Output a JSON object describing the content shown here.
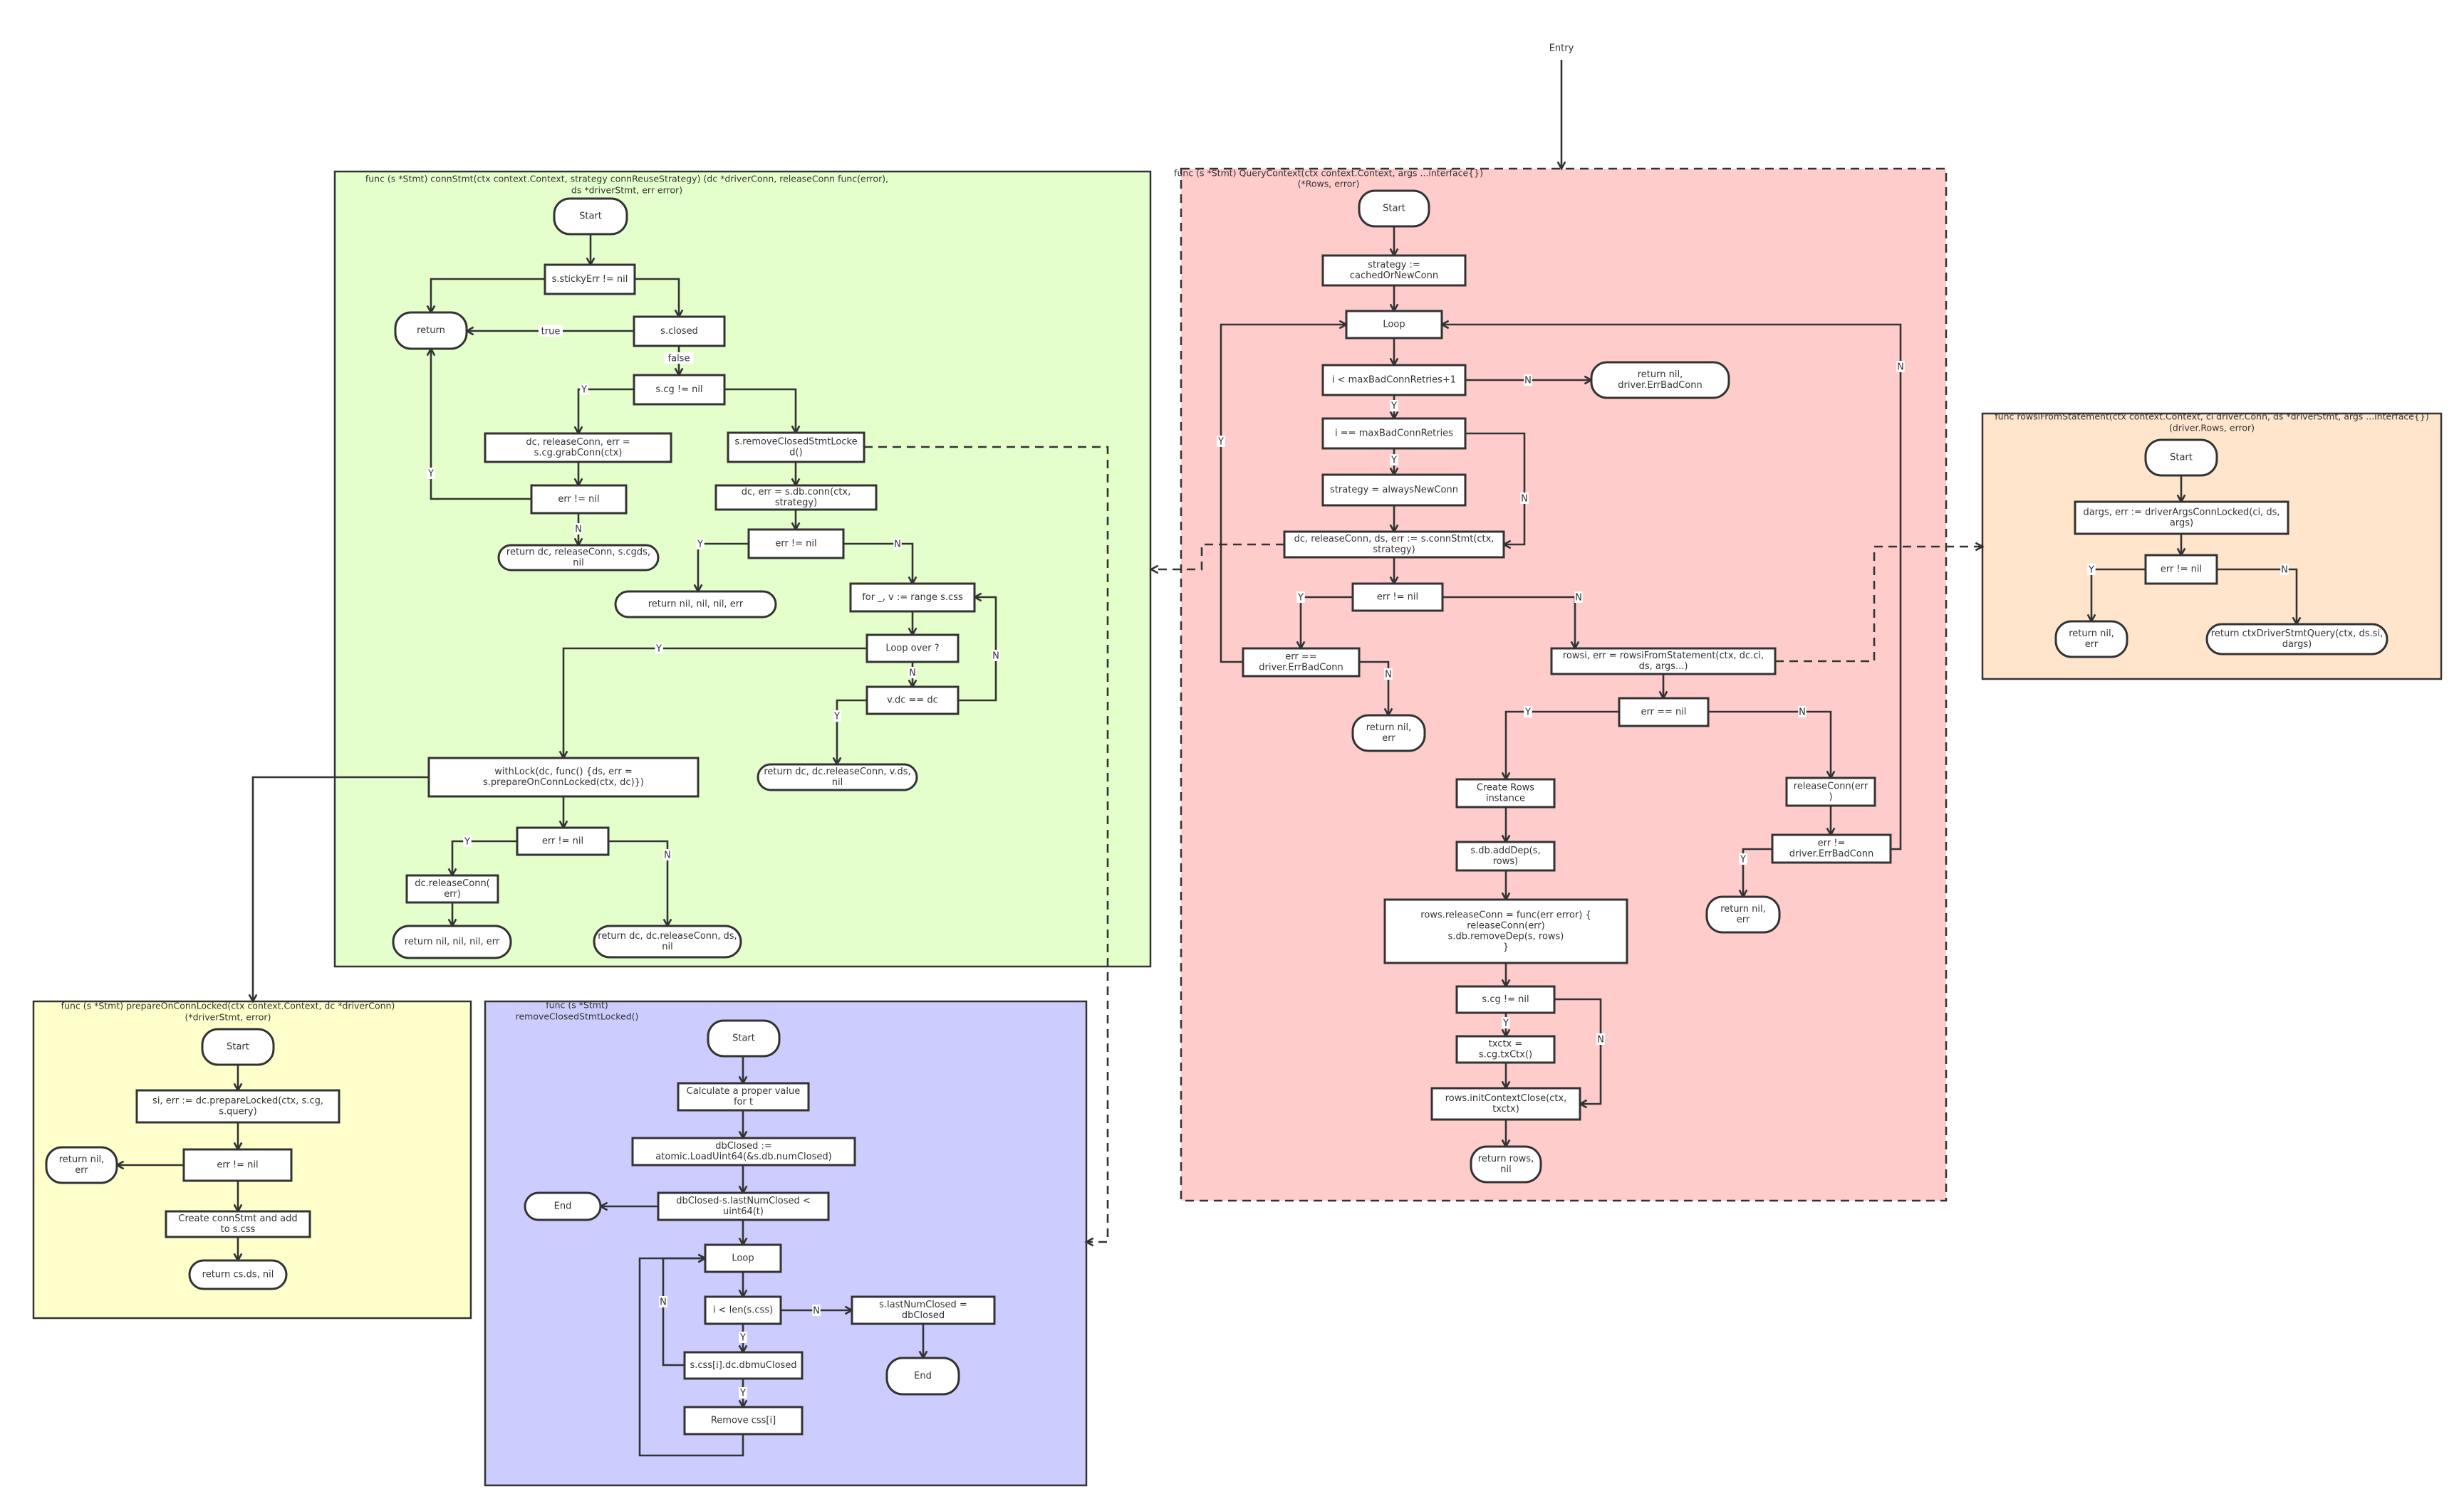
{
  "entry_label": "Entry",
  "colors": {
    "query_context_panel": "#ffcccc",
    "conn_stmt_panel": "#e5ffcc",
    "rowsi_panel": "#ffe5cc",
    "prepare_panel": "#ffffcc",
    "remove_closed_panel": "#ccccff",
    "node_white": "#ffffff",
    "node_conn_stmt": "#e5ffcc",
    "node_rowsi": "#ffe5cc",
    "node_grab_conn": "#ccccff",
    "node_remove_closed": "#ccffff",
    "node_with_lock": "#ffffcc",
    "stroke": "#333333"
  },
  "panels": [
    {
      "id": "query_context",
      "title": [
        "func (s *Stmt) QueryContext(ctx context.Context, args ...interface{})",
        "(*Rows, error)"
      ]
    },
    {
      "id": "conn_stmt",
      "title": [
        "func (s *Stmt) connStmt(ctx context.Context, strategy connReuseStrategy) (dc *driverConn, releaseConn func(error),",
        "ds *driverStmt, err error)"
      ]
    },
    {
      "id": "rowsi",
      "title": [
        "func rowsiFromStatement(ctx context.Context, ci driver.Conn, ds *driverStmt, args ...interface{})",
        "(driver.Rows, error)"
      ]
    },
    {
      "id": "prepare",
      "title": [
        "func (s *Stmt) prepareOnConnLocked(ctx context.Context, dc *driverConn)",
        "(*driverStmt, error)"
      ]
    },
    {
      "id": "remove_closed",
      "title": [
        "func (s *Stmt)",
        "removeClosedStmtLocked()"
      ]
    }
  ],
  "nodes": {
    "qc_start": [
      "Start"
    ],
    "qc_strategy_init": [
      "strategy :=",
      "cachedOrNewConn"
    ],
    "qc_loop": [
      "Loop"
    ],
    "qc_retry_check": [
      "i < maxBadConnRetries+1"
    ],
    "qc_return_bad_conn": [
      "return nil,",
      "driver.ErrBadConn"
    ],
    "qc_last_retry_check": [
      "i == maxBadConnRetries"
    ],
    "qc_strategy_always": [
      "strategy = alwaysNewConn"
    ],
    "qc_conn_stmt_call": [
      "dc, releaseConn, ds, err := s.connStmt(ctx,",
      "strategy)"
    ],
    "qc_err_check": [
      "err != nil"
    ],
    "qc_err_bad_conn": [
      "err ==",
      "driver.ErrBadConn"
    ],
    "qc_return_nil_err_1": [
      "return nil,",
      "err"
    ],
    "qc_rowsi_call": [
      "rowsi, err = rowsiFromStatement(ctx, dc.ci,",
      "ds, args...)"
    ],
    "qc_err_nil": [
      "err == nil"
    ],
    "qc_create_rows": [
      "Create Rows",
      "instance"
    ],
    "qc_release_conn": [
      "releaseConn(err",
      ")"
    ],
    "qc_add_dep": [
      "s.db.addDep(s,",
      "rows)"
    ],
    "qc_err_not_bad_conn": [
      "err !=",
      "driver.ErrBadConn"
    ],
    "qc_return_nil_err_2": [
      "return nil,",
      "err"
    ],
    "qc_release_func": [
      "rows.releaseConn = func(err error) {",
      "releaseConn(err)",
      "s.db.removeDep(s, rows)",
      "}"
    ],
    "qc_cg_check": [
      "s.cg != nil"
    ],
    "qc_txctx": [
      "txctx =",
      "s.cg.txCtx()"
    ],
    "qc_init_close": [
      "rows.initContextClose(ctx,",
      "txctx)"
    ],
    "qc_return_rows": [
      "return rows,",
      "nil"
    ],
    "cs_start": [
      "Start"
    ],
    "cs_sticky_err": [
      "s.stickyErr !=  nil"
    ],
    "cs_return": [
      "return"
    ],
    "cs_closed": [
      "s.closed"
    ],
    "cs_cg_check": [
      "s.cg != nil"
    ],
    "cs_grab_conn": [
      "dc, releaseConn, err =",
      "s.cg.grabConn(ctx)"
    ],
    "cs_remove_closed": [
      "s.removeClosedStmtLocke",
      "d()"
    ],
    "cs_err_check_1": [
      "err != nil"
    ],
    "cs_db_conn": [
      "dc, err = s.db.conn(ctx,",
      "strategy)"
    ],
    "cs_return_cgds": [
      "return dc, releaseConn, s.cgds,",
      "nil"
    ],
    "cs_err_check_2": [
      "err != nil"
    ],
    "cs_return_nil_1": [
      "return nil, nil, nil, err"
    ],
    "cs_for_range": [
      "for _, v := range s.css"
    ],
    "cs_loop_over": [
      "Loop over ?"
    ],
    "cs_vdc_check": [
      "v.dc == dc"
    ],
    "cs_return_vds": [
      "return dc, dc.releaseConn, v.ds,",
      "nil"
    ],
    "cs_with_lock": [
      "withLock(dc, func() {ds, err =",
      "s.prepareOnConnLocked(ctx, dc)})"
    ],
    "cs_err_check_3": [
      "err != nil"
    ],
    "cs_release_conn": [
      "dc.releaseConn(",
      "err)"
    ],
    "cs_return_nil_2": [
      "return nil, nil, nil, err"
    ],
    "cs_return_ds": [
      "return dc, dc.releaseConn, ds,",
      "nil"
    ],
    "rs_start": [
      "Start"
    ],
    "rs_dargs": [
      "dargs, err := driverArgsConnLocked(ci, ds,",
      "args)"
    ],
    "rs_err_check": [
      "err != nil"
    ],
    "rs_return_nil_err": [
      "return nil,",
      "err"
    ],
    "rs_return_query": [
      "return ctxDriverStmtQuery(ctx, ds.si,",
      "dargs)"
    ],
    "pc_start": [
      "Start"
    ],
    "pc_prepare_locked": [
      "si, err := dc.prepareLocked(ctx, s.cg,",
      "s.query)"
    ],
    "pc_err_check": [
      "err != nil"
    ],
    "pc_return_nil_err": [
      "return nil,",
      "err"
    ],
    "pc_create_conn_stmt": [
      "Create connStmt and add",
      "to s.css"
    ],
    "pc_return_cs": [
      "return cs.ds, nil"
    ],
    "rc_start": [
      "Start"
    ],
    "rc_calc_t": [
      "Calculate a proper value",
      "for t"
    ],
    "rc_db_closed": [
      "dbClosed :=",
      "atomic.LoadUint64(&s.db.numClosed)"
    ],
    "rc_threshold_check": [
      "dbClosed-s.lastNumClosed <",
      "uint64(t)"
    ],
    "rc_end_1": [
      "End"
    ],
    "rc_loop": [
      "Loop"
    ],
    "rc_len_check": [
      "i < len(s.css)"
    ],
    "rc_set_last": [
      "s.lastNumClosed =",
      "dbClosed"
    ],
    "rc_dbmu_closed": [
      "s.css[i].dc.dbmuClosed"
    ],
    "rc_end_2": [
      "End"
    ],
    "rc_remove_css": [
      "Remove css[i]"
    ]
  },
  "edge_labels": {
    "yes": "Y",
    "no": "N",
    "true": "true",
    "false": "false"
  }
}
